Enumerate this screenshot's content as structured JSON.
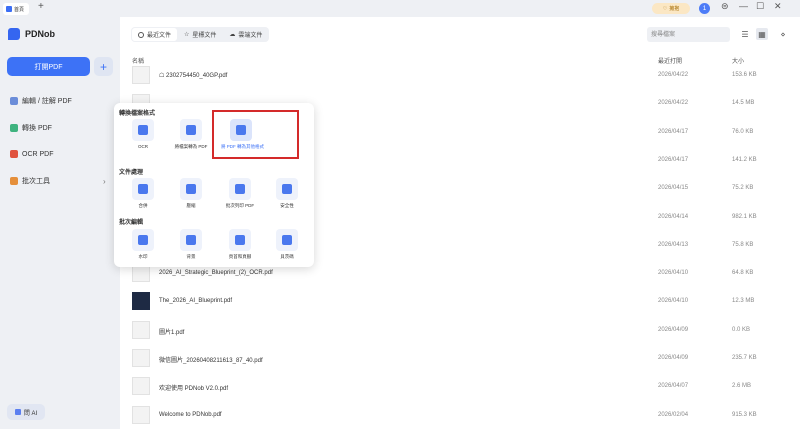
{
  "titlebar": {
    "home_tab": "首頁",
    "new_tab": "+",
    "vip_label": "擁抱",
    "user_initial": "1",
    "settings": "⊜",
    "minimize": "—",
    "maximize": "☐",
    "close": "✕"
  },
  "sidebar": {
    "app_name": "PDNob",
    "open_pdf": "打開PDF",
    "add": "+",
    "items": [
      {
        "label": "編輯 / 註解 PDF",
        "color": "#6b8dd9"
      },
      {
        "label": "轉換 PDF",
        "color": "#3fb37f"
      },
      {
        "label": "OCR PDF",
        "color": "#e0533f"
      },
      {
        "label": "批次工具",
        "color": "#e58f3a"
      }
    ],
    "ask_ai": "問 AI"
  },
  "main": {
    "tabs": [
      "最近文件",
      "星標文件",
      "雲端文件"
    ],
    "search_placeholder": "搜尋檔案",
    "columns": {
      "name": "名稱",
      "date": "最近打開",
      "size": "大小"
    },
    "files": [
      {
        "name": "☖ 2302754450_40GP.pdf",
        "date": "2026/04/22",
        "size": "153.6 KB"
      },
      {
        "name": "",
        "date": "2026/04/22",
        "size": "14.5 MB"
      },
      {
        "name": "",
        "date": "2026/04/17",
        "size": "76.0 KB"
      },
      {
        "name": "",
        "date": "2026/04/17",
        "size": "141.2 KB"
      },
      {
        "name": "",
        "date": "2026/04/15",
        "size": "75.2 KB"
      },
      {
        "name": "",
        "date": "2026/04/14",
        "size": "982.1 KB"
      },
      {
        "name": "",
        "date": "2026/04/13",
        "size": "75.8 KB"
      },
      {
        "name": "2026_AI_Strategic_Blueprint_(2)_OCR.pdf",
        "date": "2026/04/10",
        "size": "64.8 KB"
      },
      {
        "name": "The_2026_AI_Blueprint.pdf",
        "date": "2026/04/10",
        "size": "12.3 MB"
      },
      {
        "name": "圖片1.pdf",
        "date": "2026/04/09",
        "size": "0.0 KB"
      },
      {
        "name": "微信圖片_20260408211613_87_40.pdf",
        "date": "2026/04/09",
        "size": "235.7 KB"
      },
      {
        "name": "欢迎使用 PDNob V2.0.pdf",
        "date": "2026/04/07",
        "size": "2.6 MB"
      },
      {
        "name": "Welcome to PDNob.pdf",
        "date": "2026/02/04",
        "size": "915.3 KB"
      }
    ]
  },
  "popup": {
    "sections": [
      {
        "title": "轉換檔案格式",
        "tools": [
          "OCR",
          "將檔案轉為 PDF",
          "將 PDF 轉為其他格式"
        ]
      },
      {
        "title": "文件處理",
        "tools": [
          "合併",
          "壓縮",
          "批次列印 PDF",
          "安全性"
        ]
      },
      {
        "title": "批次編輯",
        "tools": [
          "水印",
          "背景",
          "頁首和頁腳",
          "貝茨碼"
        ]
      }
    ]
  }
}
